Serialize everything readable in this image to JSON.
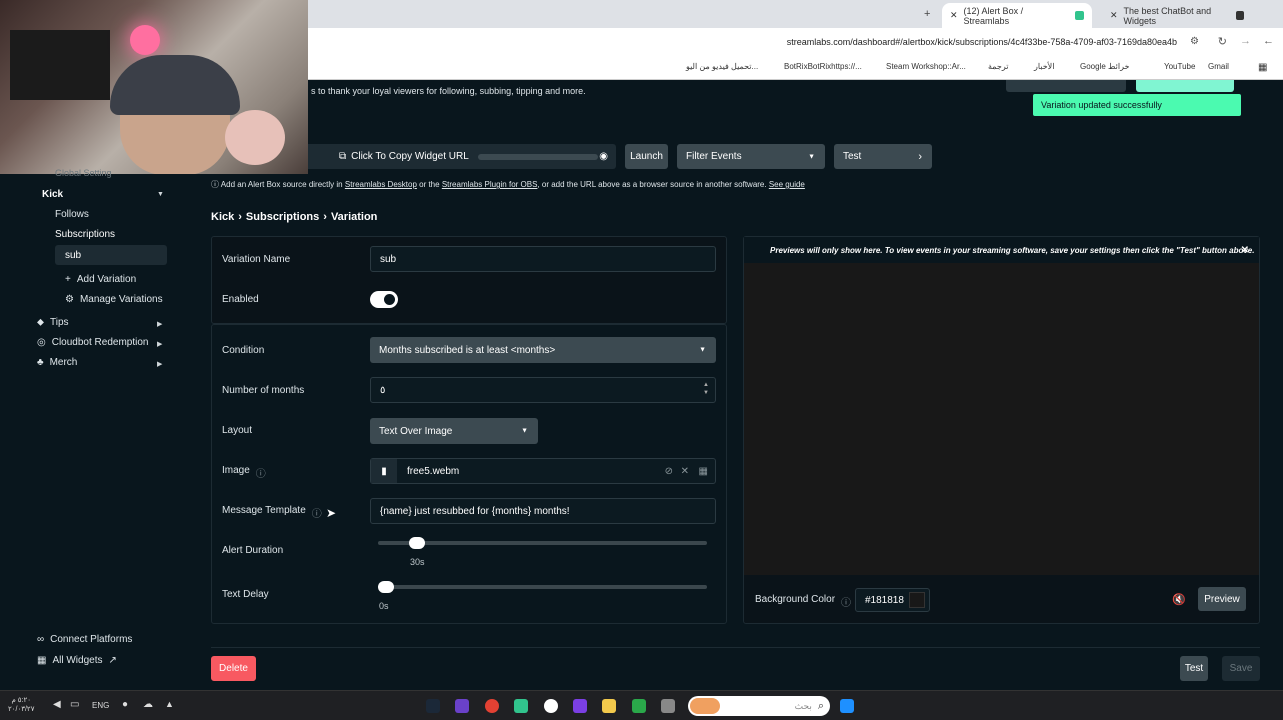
{
  "browser": {
    "tabs": [
      {
        "label": "(12) Alert Box / Streamlabs"
      },
      {
        "label": "The best ChatBot and Widgets"
      }
    ],
    "url": "streamlabs.com/dashboard#/alertbox/kick/subscriptions/4c4f33be-758a-4709-af03-7169da80ea4b",
    "bookmarks": [
      "تحميل فيديو من اليو...",
      "BotRixBotRixhttps://...",
      "Steam Workshop::Ar...",
      "ترجمة",
      "الأخبار",
      "Google خرائط",
      "YouTube",
      "Gmail"
    ]
  },
  "header": {
    "intro_text": "s to thank your loyal viewers for following, subbing, tipping and more.",
    "toast": "Variation updated successfully"
  },
  "toolbar": {
    "copy_url": "Click To Copy Widget URL",
    "launch": "Launch",
    "filter_events": "Filter Events",
    "test": "Test",
    "info_prefix": "Add an Alert Box source directly in",
    "info_link1": "Streamlabs Desktop",
    "info_mid": "or the",
    "info_link2": "Streamlabs Plugin for OBS",
    "info_suffix": ", or add the URL above as a browser source in another software.",
    "info_link3": "See guide"
  },
  "sidebar": {
    "partial_top": "Global Setting",
    "kick": "Kick",
    "follows": "Follows",
    "subscriptions": "Subscriptions",
    "sub": "sub",
    "add_variation": "Add Variation",
    "manage_variations": "Manage Variations",
    "tips": "Tips",
    "cloudbot": "Cloudbot Redemption",
    "merch": "Merch",
    "connect_platforms": "Connect Platforms",
    "all_widgets": "All Widgets"
  },
  "breadcrumb": {
    "a": "Kick",
    "b": "Subscriptions",
    "c": "Variation",
    "sep": "›"
  },
  "form": {
    "variation_name_label": "Variation Name",
    "variation_name_value": "sub",
    "enabled_label": "Enabled",
    "condition_label": "Condition",
    "condition_value": "Months subscribed is at least <months>",
    "months_label": "Number of months",
    "months_value": "٥",
    "layout_label": "Layout",
    "layout_value": "Text Over Image",
    "image_label": "Image",
    "image_value": "free5.webm",
    "message_label": "Message Template",
    "message_value": "{name} just resubbed for {months} months!",
    "duration_label": "Alert Duration",
    "duration_value": "30s",
    "duration_fraction": 0.1,
    "delay_label": "Text Delay",
    "delay_value": "0s",
    "delay_fraction": 0.0
  },
  "preview": {
    "notice": "Previews will only show here. To view events in your streaming software, save your settings then click the \"Test\" button above.",
    "bg_label": "Background Color",
    "bg_value": "#181818",
    "preview_btn": "Preview"
  },
  "footer": {
    "delete": "Delete",
    "test": "Test",
    "save": "Save"
  },
  "taskbar": {
    "lang": "ENG",
    "search_placeholder": "بحث",
    "time": "٥:٢٠ م",
    "date": "٢٠/٠٣/٢٧"
  },
  "colors": {
    "accent": "#80f5d2",
    "delete": "#f85961",
    "dark": "#09161d",
    "toast": "#4bfab0"
  }
}
